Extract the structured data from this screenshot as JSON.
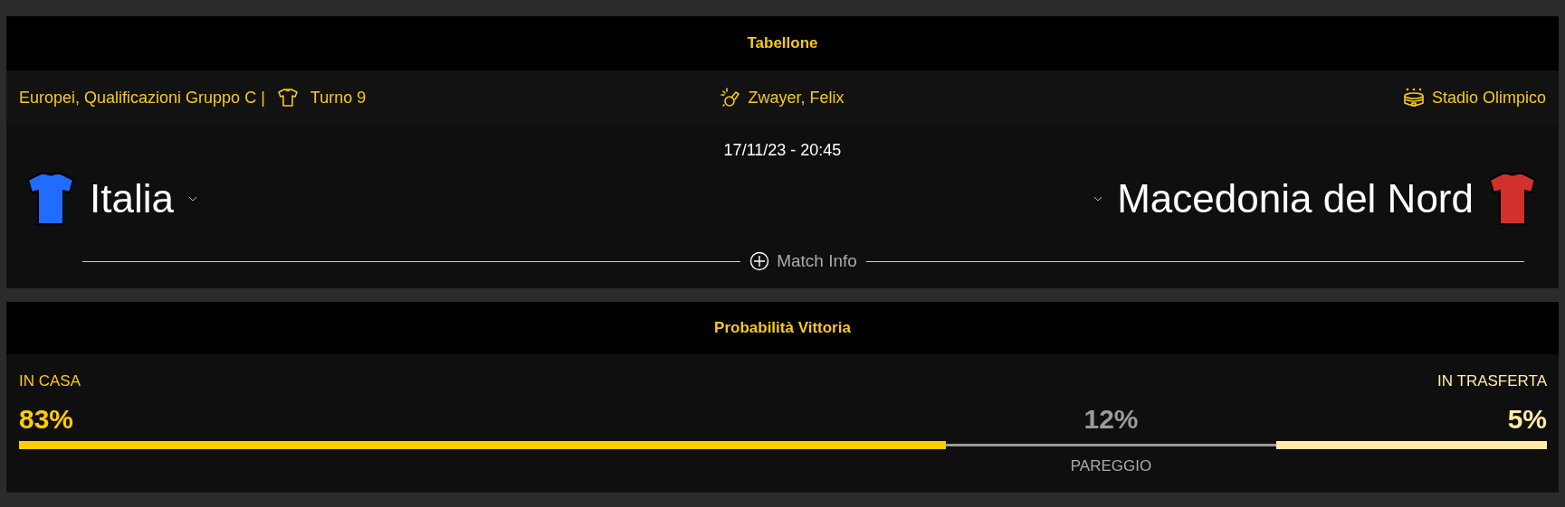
{
  "scoreboard": {
    "title": "Tabellone",
    "info": {
      "competition": "Europei, Qualificazioni Gruppo C |",
      "round": "Turno 9",
      "referee": "Zwayer, Felix",
      "venue": "Stadio Olimpico"
    },
    "datetime": "17/11/23 - 20:45",
    "teams": [
      {
        "name": "Italia",
        "color": "#1f6cff"
      },
      {
        "name": "Macedonia del Nord",
        "color": "#d0312d"
      }
    ],
    "match_info": "Match Info"
  },
  "win_probability": {
    "title": "Probabilità Vittoria",
    "outcomes": [
      {
        "kind": "home",
        "label": "IN CASA",
        "value": "83%"
      },
      {
        "kind": "draw",
        "label": "PAREGGIO",
        "value": "12%"
      },
      {
        "kind": "away",
        "label": "IN TRASFERTA",
        "value": "5%"
      }
    ]
  }
}
